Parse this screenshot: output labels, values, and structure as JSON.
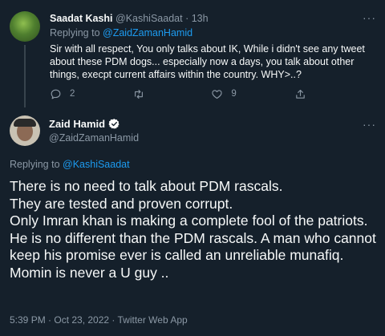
{
  "parent_tweet": {
    "author_name": "Saadat Kashi",
    "author_handle": "@KashiSaadat",
    "separator": "·",
    "time": "13h",
    "replying_prefix": "Replying to ",
    "replying_to": "@ZaidZamanHamid",
    "text": "Sir with all respect,  You only talks about IK, While i didn't see any tweet about these PDM dogs... especially now a days, you talk about other things, execpt current affairs within the country. WHY>..?",
    "more": "···",
    "reply_count": "2",
    "retweet_count": "",
    "like_count": "9"
  },
  "main_tweet": {
    "author_name": "Zaid Hamid",
    "author_handle": "@ZaidZamanHamid",
    "more": "···",
    "replying_prefix": "Replying to ",
    "replying_to": "@KashiSaadat",
    "text_lines": [
      "There is no need to talk about PDM rascals.",
      "They are tested and proven corrupt.",
      "Only Imran khan is making a complete fool of the patriots.",
      "He is no different than the PDM rascals. A man who cannot keep his promise ever is called an unreliable munafiq. Momin is never a U guy .."
    ],
    "timestamp": "5:39 PM · Oct 23, 2022 · Twitter Web App"
  },
  "colors": {
    "background": "#15202b",
    "text": "#f7f9f9",
    "muted": "#8b98a5",
    "link": "#1d9bf0",
    "verified_badge": "#ffffff"
  }
}
